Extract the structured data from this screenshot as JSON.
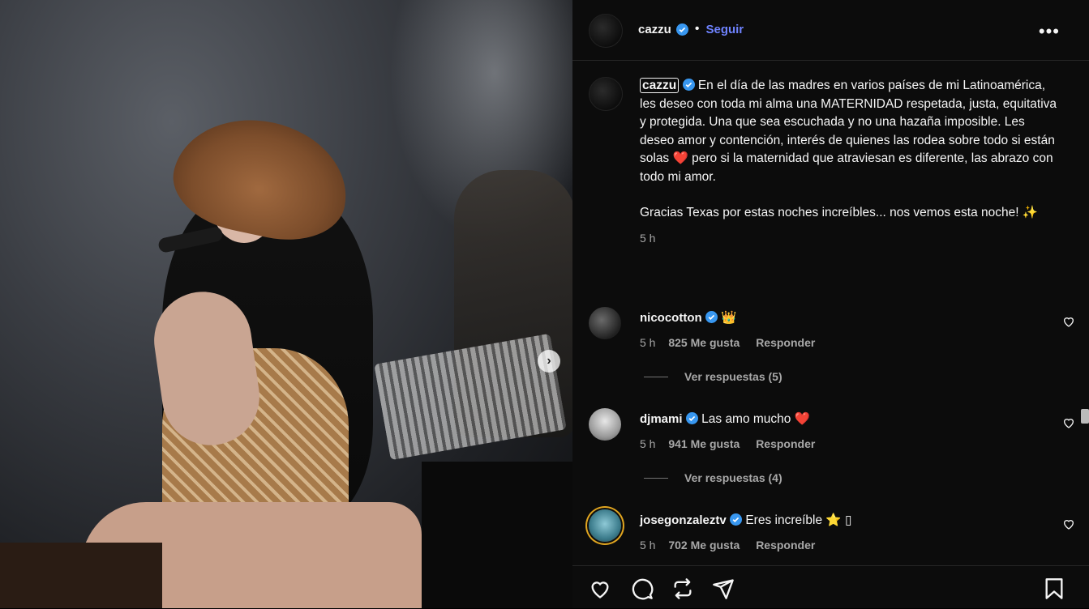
{
  "post": {
    "author": "cazzu",
    "follow_label": "Seguir",
    "separator": "•",
    "caption_p1": "En el día de las madres en varios países de mi Latinoamérica, les deseo con toda mi alma una MATERNIDAD respetada, justa, equitativa y protegida. Una que sea escuchada y no una hazaña imposible. Les deseo amor y contención, interés de quienes las rodea sobre todo si están solas",
    "caption_p1_emoji": "❤️",
    "caption_p1_rest": "pero si la maternidad que atraviesan es diferente, las abrazo con todo mi amor.",
    "caption_p2": "Gracias Texas por estas noches increíbles... nos vemos esta noche!",
    "caption_p2_emoji": "✨",
    "time": "5 h"
  },
  "comments": [
    {
      "user": "nicocotton",
      "text": "👑",
      "time": "5 h",
      "likes": "825 Me gusta",
      "reply": "Responder",
      "view_replies": "Ver respuestas (5)"
    },
    {
      "user": "djmami",
      "text": "Las amo mucho ❤️",
      "time": "5 h",
      "likes": "941 Me gusta",
      "reply": "Responder",
      "view_replies": "Ver respuestas (4)"
    },
    {
      "user": "josegonzaleztv",
      "text": "Eres increíble ⭐ ▯",
      "time": "5 h",
      "likes": "702 Me gusta",
      "reply": "Responder"
    }
  ],
  "colors": {
    "accent_follow": "#6f83ff",
    "verified": "#3897f0",
    "panel_bg": "#0c0c0c"
  },
  "icons": [
    "like-icon",
    "comment-icon",
    "share-icon",
    "send-icon",
    "save-icon",
    "more-options-icon",
    "next-image-icon",
    "verified-icon",
    "heart-icon"
  ]
}
